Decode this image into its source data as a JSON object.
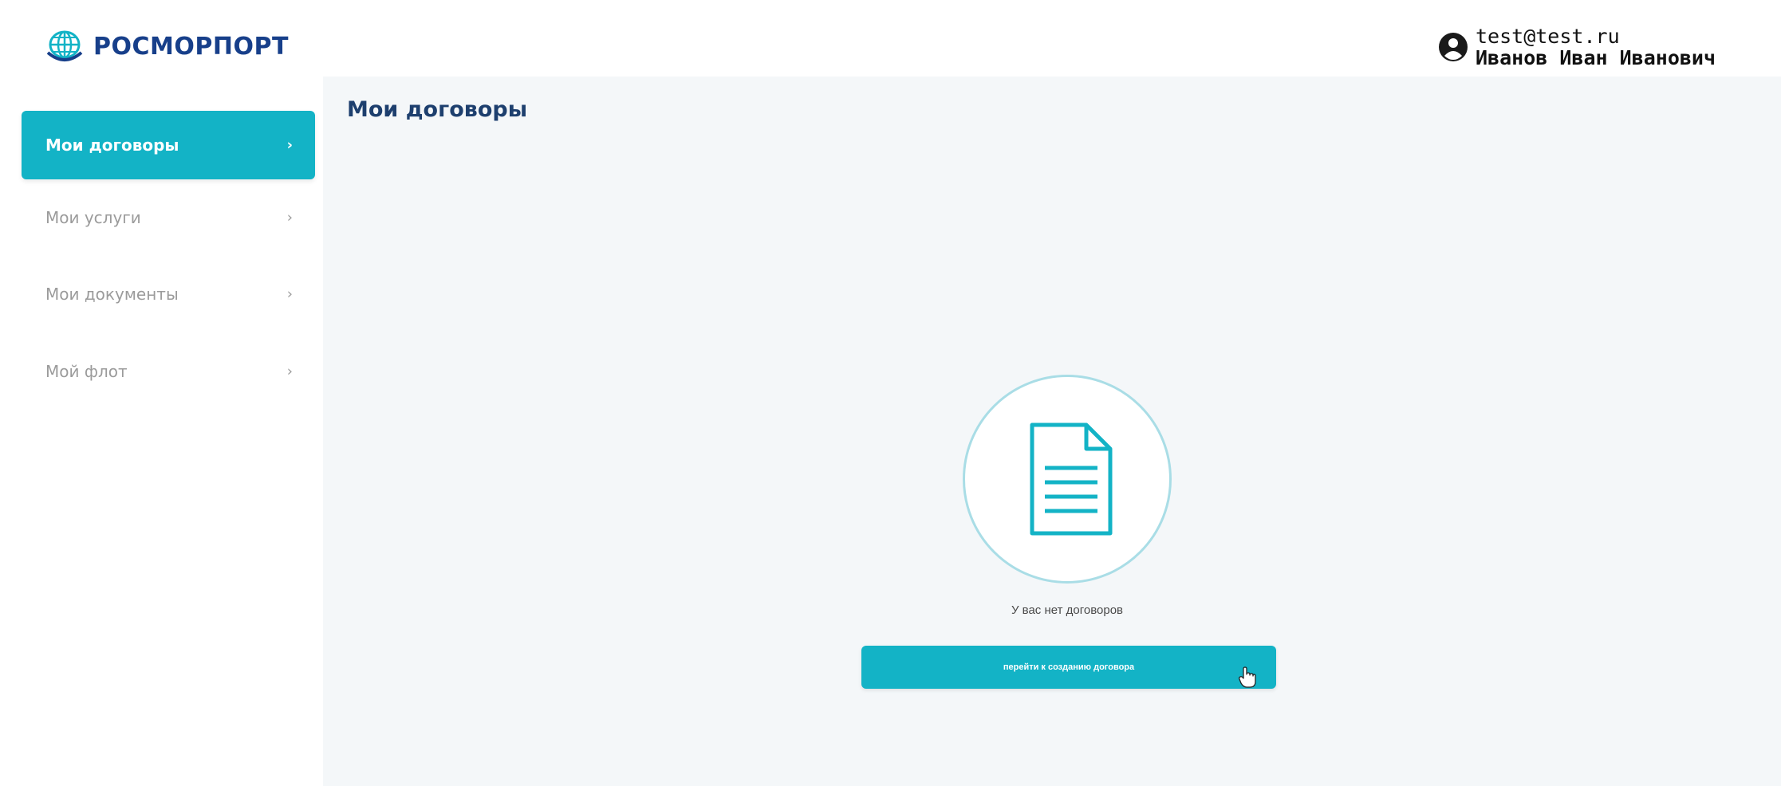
{
  "header": {
    "logo_text": "РОСМОРПОРТ",
    "user_email": "test@test.ru",
    "user_name": "Иванов Иван Иванович",
    "brand_color": "#173f8a",
    "logo_icon": "globe-anchor-logo-icon",
    "user_icon": "user-circle-icon"
  },
  "sidebar": {
    "accent_color": "#13b3c6",
    "items": [
      {
        "label": "Мои договоры",
        "active": true
      },
      {
        "label": "Мои услуги",
        "active": false
      },
      {
        "label": "Мои документы",
        "active": false
      },
      {
        "label": "Мой флот",
        "active": false
      }
    ]
  },
  "main": {
    "title": "Мои договоры",
    "empty_icon": "document-icon",
    "empty_text": "У вас нет договоров",
    "button_label": "перейти к созданию договора"
  }
}
